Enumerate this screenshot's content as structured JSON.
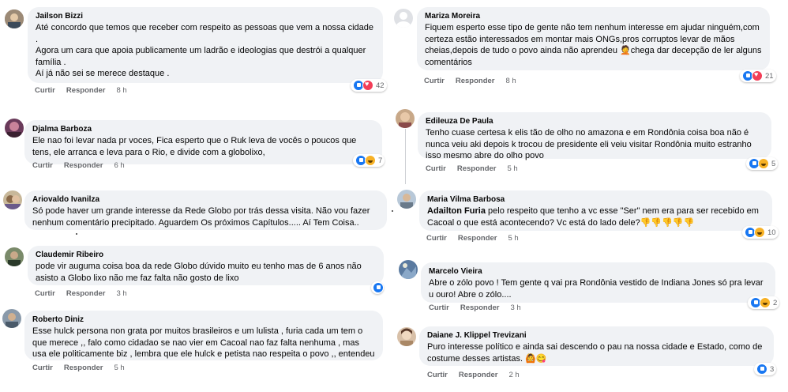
{
  "comments_left": [
    {
      "author": "Jailson Bizzi",
      "text": "Até concordo que temos que receber com respeito as pessoas que vem a nossa cidade\n.\nAgora um cara que apoia publicamente um ladrão e ideologias que destrói a qualquer família .\nAí já não sei se merece destaque .",
      "like": "Curtir",
      "reply": "Responder",
      "time": "8 h",
      "reactions": "42"
    },
    {
      "author": "Djalma Barboza",
      "text": "Ele nao foi levar nada pr voces, Fica esperto que o Ruk leva de vocês o poucos que tens, ele arranca e leva para o Rio, e divide com a globolixo,",
      "like": "Curtir",
      "reply": "Responder",
      "time": "6 h",
      "reactions": "7"
    },
    {
      "author": "Ariovaldo Ivanilza",
      "text": "Só pode haver um grande interesse da Rede Globo por trás dessa visita. Não vou fazer nenhum comentário precipitado. Aguardem Os próximos Capítulos..... Aí Tem Coisa..",
      "like": "Curtir",
      "reply": "Responder",
      "time": "",
      "reactions": ""
    },
    {
      "author": "Claudemir Ribeiro",
      "text": "pode vir auguma coisa boa da rede Globo dúvido muito eu tenho mas de 6 anos não asisto a Globo lixo não me faz falta não gosto de lixo",
      "like": "Curtir",
      "reply": "Responder",
      "time": "3 h",
      "reactions": ""
    },
    {
      "author": "Roberto Diniz",
      "text": "Esse hulck persona non grata por muitos brasileiros e um lulista , furia cada um tem o que merece ,, falo como cidadao se nao vier em Cacoal nao faz falta nenhuma , mas usa ele politicamente biz , lembra que ele hulck e petista nao respeita o povo ,, entendeu",
      "like": "Curtir",
      "reply": "Responder",
      "time": "5 h",
      "reactions": ""
    }
  ],
  "comments_right": [
    {
      "author": "Mariza Moreira",
      "text": "Fiquem esperto esse tipo de gente não tem nenhum interesse em ajudar ninguém,com certeza estão interessados em montar mais ONGs,pros corruptos levar de mãos cheias,depois de tudo o povo ainda não aprendeu ",
      "text_end": "chega dar decepção de ler alguns comentários",
      "like": "Curtir",
      "reply": "Responder",
      "time": "8 h",
      "reactions": "21"
    },
    {
      "author": "Edileuza De Paula",
      "text": "Tenho cuase certesa k elis tão de olho no amazona e em Rondônia coisa boa não é nunca veiu aki depois k trocou de presidente eli veiu visitar Rondônia muito estranho isso mesmo abre do olho povo",
      "like": "Curtir",
      "reply": "Responder",
      "time": "5 h",
      "reactions": "5"
    },
    {
      "author": "Maria Vilma Barbosa",
      "mention": "Adailton Furia",
      "text": " pelo respeito que tenho a vc esse \"Ser\" nem era para ser recebido em Cacoal o que está acontecendo? Vc está do lado dele?",
      "emojis": "👎👎👎👎👎",
      "like": "Curtir",
      "reply": "Responder",
      "time": "5 h",
      "reactions": "10"
    },
    {
      "author": "Marcelo Vieira",
      "text": "Abre o zólo povo ! Tem gente q vai pra Rondônia vestido de Indiana Jones só pra levar u ouro! Abre o zólo....",
      "like": "Curtir",
      "reply": "Responder",
      "time": "3 h",
      "reactions": "2"
    },
    {
      "author": "Daiane J. Klippel Trevizani",
      "text": "Puro interesse político e ainda sai descendo o pau na nossa cidade e Estado, como de costume desses artistas. ",
      "like": "Curtir",
      "reply": "Responder",
      "time": "2 h",
      "reactions": "3"
    }
  ],
  "colors": {
    "bubble": "#f0f2f5",
    "like": "#1877f2",
    "love": "#f33e58",
    "haha": "#f7b125",
    "meta": "#65676b"
  }
}
